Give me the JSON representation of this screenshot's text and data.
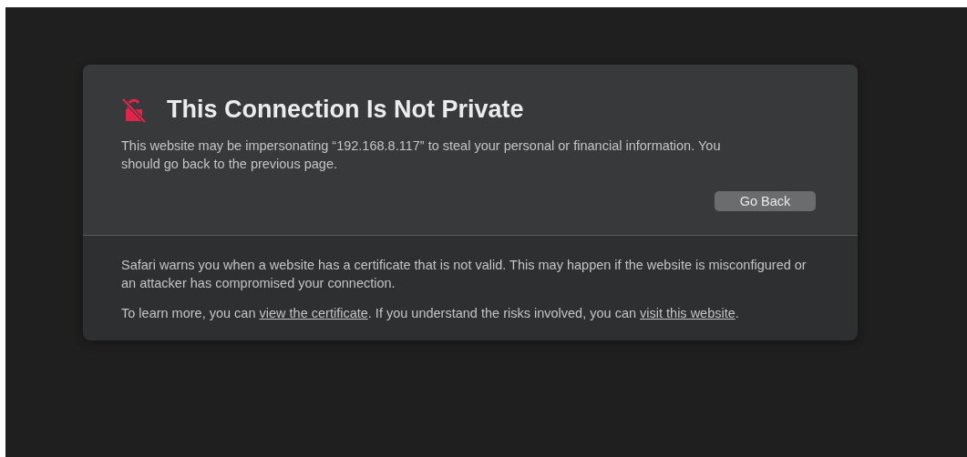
{
  "title": "This Connection Is Not Private",
  "message": "This website may be impersonating “192.168.8.117” to steal your personal or financial information. You should go back to the previous page.",
  "button": "Go Back",
  "details": [
    {
      "parts": [
        {
          "kind": "text",
          "text": "Safari warns you when a website has a certificate that is not valid. This may happen if the website is misconfigured or an attacker has compromised your connection."
        }
      ]
    },
    {
      "parts": [
        {
          "kind": "text",
          "text": "To learn more, you can "
        },
        {
          "kind": "link",
          "text": "view the certificate"
        },
        {
          "kind": "text",
          "text": ". If you understand the risks involved, you can "
        },
        {
          "kind": "link",
          "text": "visit this website"
        },
        {
          "kind": "text",
          "text": "."
        }
      ]
    }
  ]
}
